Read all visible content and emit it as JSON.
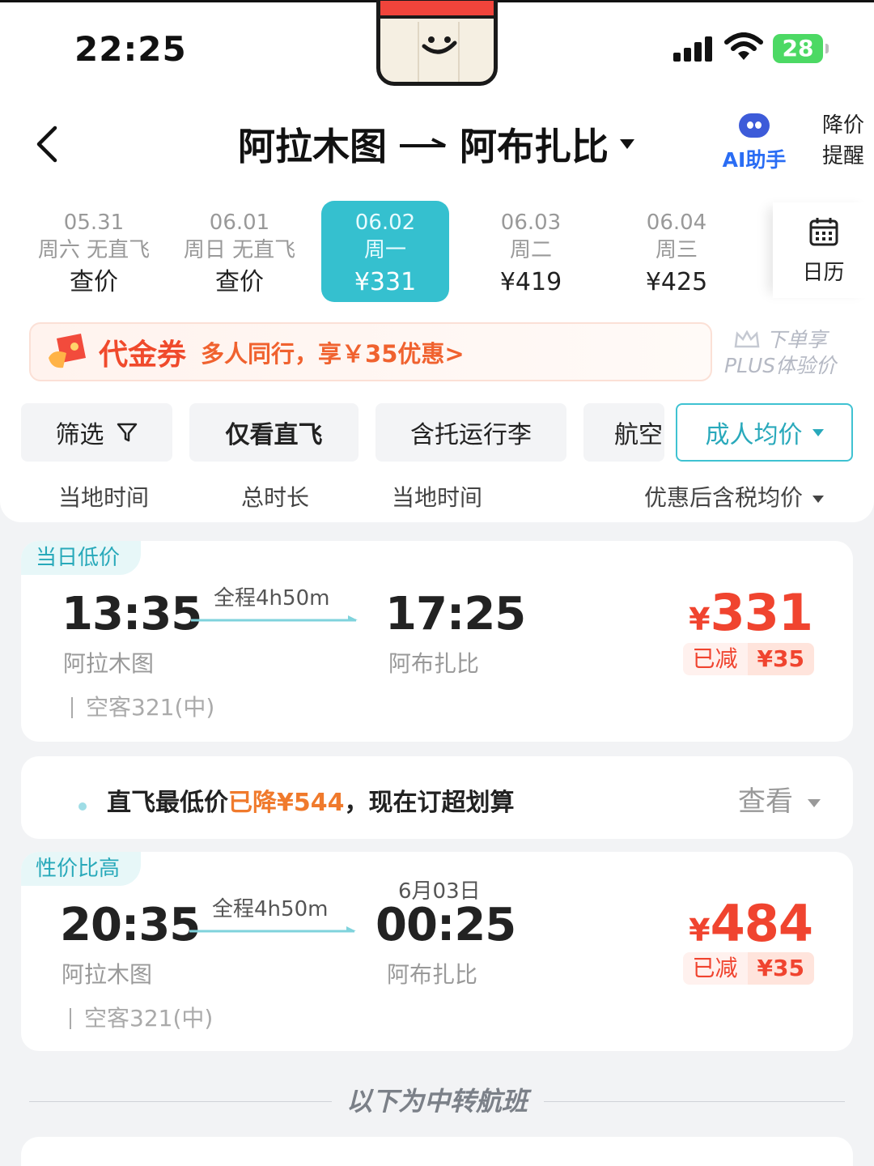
{
  "status_bar": {
    "time": "22:25",
    "battery": "28"
  },
  "header": {
    "origin": "阿拉木图",
    "destination": "阿布扎比",
    "ai_assistant": "AI助手",
    "price_alert_line1": "降价",
    "price_alert_line2": "提醒"
  },
  "dates": [
    {
      "date": "05.31",
      "weekday": "周六 无直飞",
      "price": "查价"
    },
    {
      "date": "06.01",
      "weekday": "周日 无直飞",
      "price": "查价"
    },
    {
      "date": "06.02",
      "weekday": "周一",
      "price": "¥331"
    },
    {
      "date": "06.03",
      "weekday": "周二",
      "price": "¥419"
    },
    {
      "date": "06.04",
      "weekday": "周三",
      "price": "¥425"
    }
  ],
  "calendar_label": "日历",
  "coupon": {
    "title": "代金券",
    "text": "多人同行，享￥35优惠>"
  },
  "plus": {
    "line1": "下单享",
    "line2": "PLUS体验价"
  },
  "filters": {
    "filter": "筛选",
    "direct": "仅看直飞",
    "baggage": "含托运行李",
    "airline": "航空",
    "adult_price": "成人均价"
  },
  "sort": {
    "dep_time": "当地时间",
    "duration": "总时长",
    "arr_time": "当地时间",
    "price": "优惠后含税均价"
  },
  "flights": [
    {
      "tag": "当日低价",
      "dep_time": "13:35",
      "dep_city": "阿拉木图",
      "duration": "全程4h50m",
      "arr_time": "17:25",
      "arr_city": "阿布扎比",
      "aircraft": "空客321(中)",
      "currency": "¥",
      "price": "331",
      "discount_label": "已减",
      "discount_value": "¥35"
    },
    {
      "tag": "性价比高",
      "dep_time": "20:35",
      "dep_city": "阿拉木图",
      "duration": "全程4h50m",
      "arr_date": "6月03日",
      "arr_time": "00:25",
      "arr_city": "阿布扎比",
      "aircraft": "空客321(中)",
      "currency": "¥",
      "price": "484",
      "discount_label": "已减",
      "discount_value": "¥35"
    }
  ],
  "notice": {
    "text_a": "直飞最低价",
    "text_highlight": "已降¥544",
    "text_b": "，现在订超划算",
    "view": "查看"
  },
  "transfer_divider": "以下为中转航班",
  "colors": {
    "accent": "#35c0cf",
    "price_red": "#f0442f",
    "coupon_orange": "#f0622f",
    "ai_blue": "#2a6df4"
  }
}
